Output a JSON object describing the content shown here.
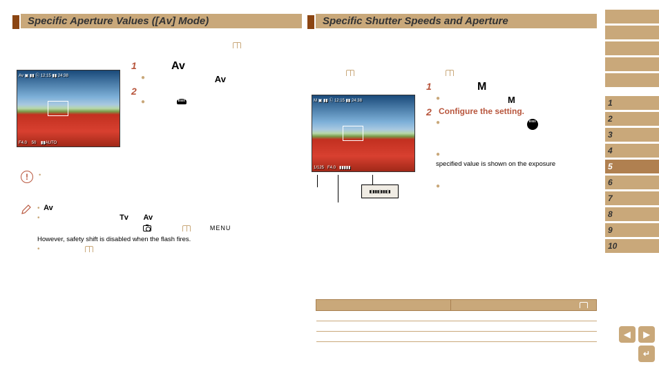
{
  "left": {
    "title": "Specific Aperture Values ([Av] Mode)",
    "step1_num": "1",
    "step1_mode": "Av",
    "step1_mode2": "Av",
    "step2_num": "2",
    "warn_bullet": "•",
    "note_label1": "Av",
    "note_tv": "Tv",
    "note_av": "Av",
    "note_menu": "MENU",
    "note_safety": "However, safety shift is disabled when the flash fires.",
    "note_bullet2": "•"
  },
  "right": {
    "title": "Specific Shutter Speeds and Aperture",
    "step1_num": "1",
    "step1_mode": "M",
    "step1_mode2": "M",
    "step2_num": "2",
    "step2_label": "Configure the setting.",
    "line_specified": "specified value is shown on the exposure"
  },
  "sidebar": {
    "tabs": [
      "",
      "",
      "",
      "",
      ""
    ],
    "nums": [
      "1",
      "2",
      "3",
      "4",
      "5",
      "6",
      "7",
      "8",
      "9",
      "10"
    ]
  },
  "active_tab_index": 4
}
